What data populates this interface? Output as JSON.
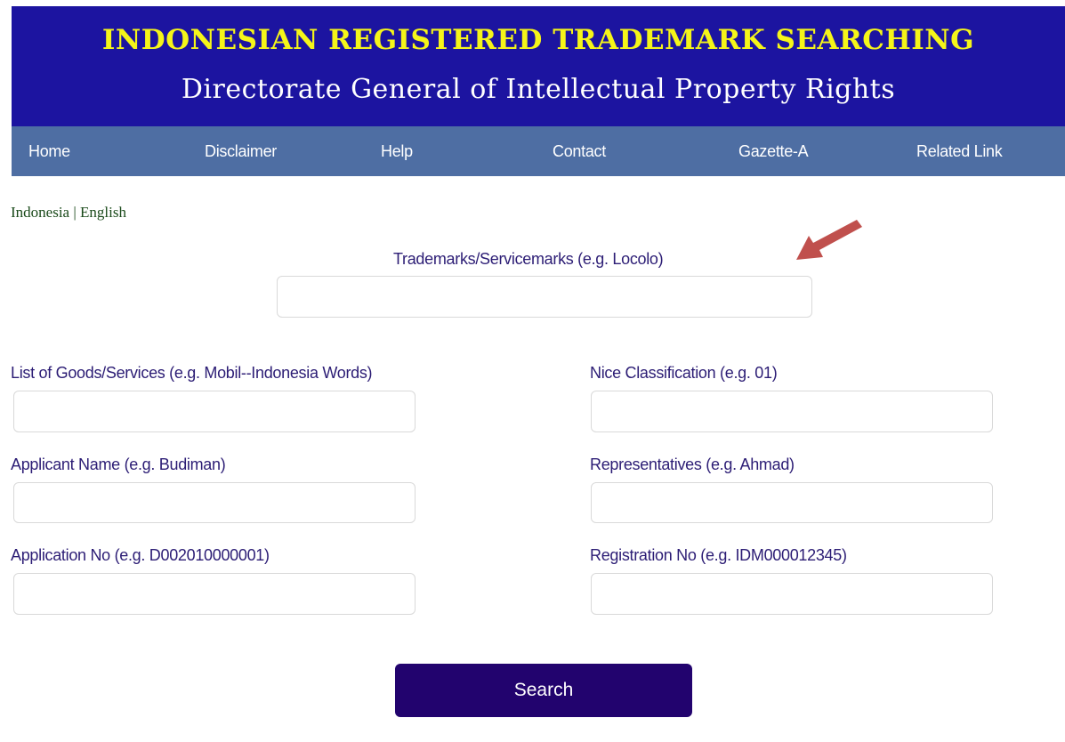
{
  "header": {
    "title": "INDONESIAN REGISTERED TRADEMARK SEARCHING",
    "subtitle": "Directorate General of Intellectual Property Rights"
  },
  "nav": {
    "home": "Home",
    "disclaimer": "Disclaimer",
    "help": "Help",
    "contact": "Contact",
    "gazette": "Gazette-A",
    "related": "Related Link"
  },
  "language": {
    "indonesia": "Indonesia",
    "separator": " | ",
    "english": "English"
  },
  "form": {
    "trademark_label": "Trademarks/Servicemarks (e.g. Locolo)",
    "trademark_value": "",
    "goods_label": "List of Goods/Services (e.g. Mobil--Indonesia Words)",
    "goods_value": "",
    "nice_label": "Nice Classification (e.g. 01)",
    "nice_value": "",
    "applicant_label": "Applicant Name (e.g. Budiman)",
    "applicant_value": "",
    "representatives_label": "Representatives (e.g. Ahmad)",
    "representatives_value": "",
    "application_label": "Application No (e.g. D002010000001)",
    "application_value": "",
    "registration_label": "Registration No (e.g. IDM000012345)",
    "registration_value": "",
    "search_label": "Search"
  },
  "annotation": {
    "arrow_icon": "arrow-pointing-down-left-icon",
    "arrow_color": "#c0504d"
  },
  "colors": {
    "banner_bg": "#1c14a0",
    "title_color": "#f5f519",
    "nav_bg": "#4e6ea3",
    "label_color": "#2c1d75",
    "button_bg": "#22036e"
  }
}
